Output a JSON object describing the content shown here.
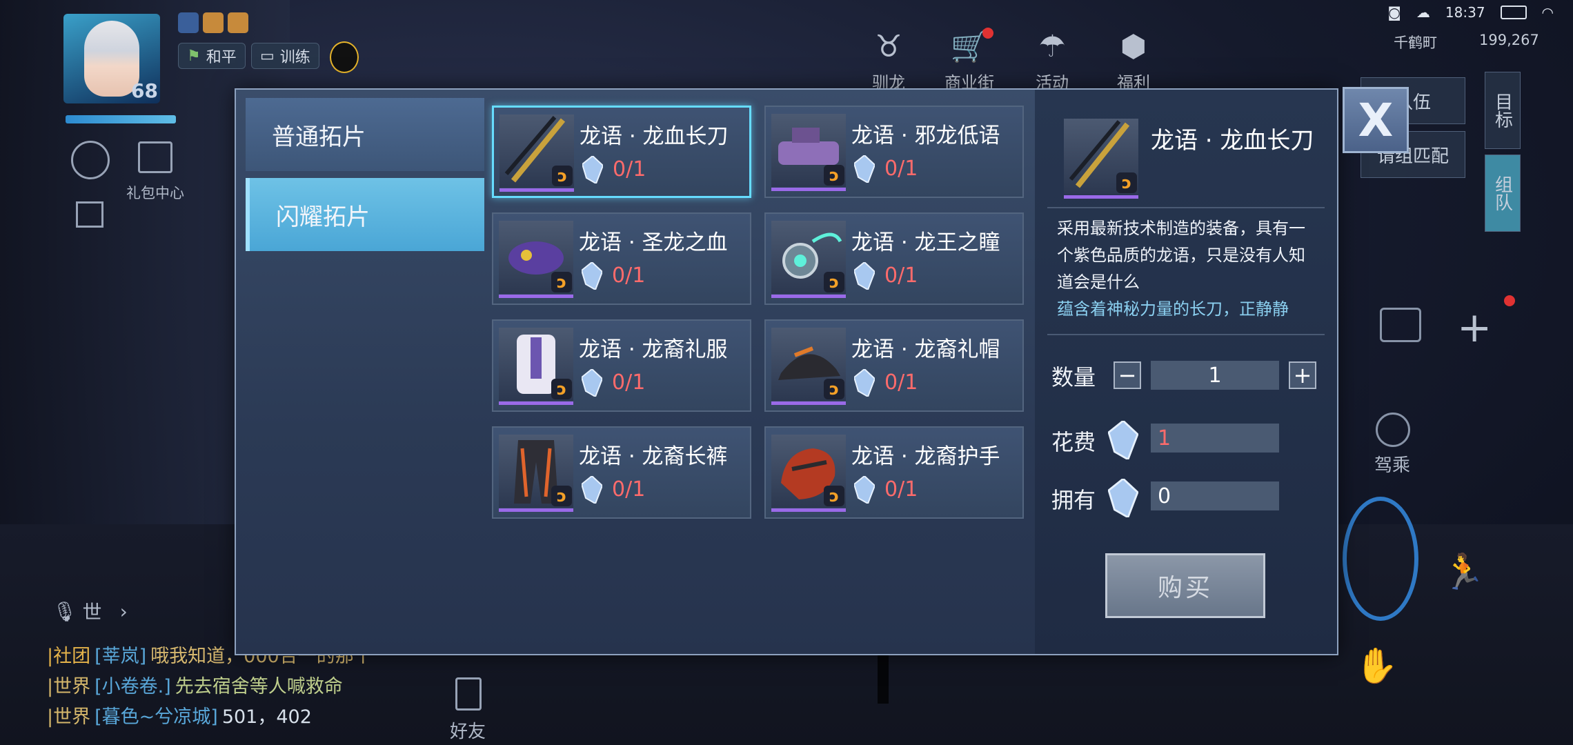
{
  "hud": {
    "player_level": "68",
    "mode_chip_peace": "和平",
    "mode_chip_train": "训练",
    "gift_center": "礼包中心",
    "top_icons": [
      {
        "icon": "dragon-icon",
        "label": "驯龙"
      },
      {
        "icon": "cart-icon",
        "label": "商业街"
      },
      {
        "icon": "parachute-icon",
        "label": "活动"
      },
      {
        "icon": "welfare-icon",
        "label": "福利"
      }
    ],
    "status": {
      "time": "18:37"
    },
    "location": "千鹤町",
    "coords": "199,267",
    "right_buttons": {
      "team": "队伍",
      "match": "请组匹配",
      "target": "目标",
      "group": "组队",
      "drive": "驾乘"
    },
    "channel_label": "世",
    "friends": "好友",
    "chat": [
      {
        "channel": "|社团",
        "name": "[莘岚]",
        "msg": "哦我知道，000合一的那个"
      },
      {
        "channel": "|世界",
        "name": "[小卷卷.]",
        "msg": "先去宿舍等人喊救命"
      },
      {
        "channel": "|世界",
        "name": "[暮色~兮凉城]",
        "msg": "501，402"
      }
    ]
  },
  "modal": {
    "tabs": [
      {
        "label": "普通拓片",
        "active": false
      },
      {
        "label": "闪耀拓片",
        "active": true
      }
    ],
    "items": [
      {
        "name": "龙语 · 龙血长刀",
        "count": "0/1",
        "icon": "sword-icon",
        "selected": true
      },
      {
        "name": "龙语 · 邪龙低语",
        "count": "0/1",
        "icon": "gun-icon",
        "selected": false
      },
      {
        "name": "龙语 · 圣龙之血",
        "count": "0/1",
        "icon": "mask-icon",
        "selected": false
      },
      {
        "name": "龙语 · 龙王之瞳",
        "count": "0/1",
        "icon": "eye-ring-icon",
        "selected": false
      },
      {
        "name": "龙语 · 龙裔礼服",
        "count": "0/1",
        "icon": "suit-icon",
        "selected": false
      },
      {
        "name": "龙语 · 龙裔礼帽",
        "count": "0/1",
        "icon": "cap-icon",
        "selected": false
      },
      {
        "name": "龙语 · 龙裔长裤",
        "count": "0/1",
        "icon": "pants-icon",
        "selected": false
      },
      {
        "name": "龙语 · 龙裔护手",
        "count": "0/1",
        "icon": "glove-icon",
        "selected": false
      }
    ],
    "detail": {
      "name": "龙语 · 龙血长刀",
      "description": "采用最新技术制造的装备，具有一个紫色品质的龙语，只是没有人知道会是什么",
      "flavor": "蕴含着神秘力量的长刀，正静静",
      "quantity_label": "数量",
      "quantity": "1",
      "cost_label": "花费",
      "cost": "1",
      "own_label": "拥有",
      "own": "0",
      "buy_label": "购买",
      "minus": "−",
      "plus": "+"
    },
    "close_glyph": "X",
    "colors": {
      "accent_selected": "#66dcff",
      "cost_red": "#ff6b6b",
      "purple_quality": "#9a6ae8"
    }
  }
}
